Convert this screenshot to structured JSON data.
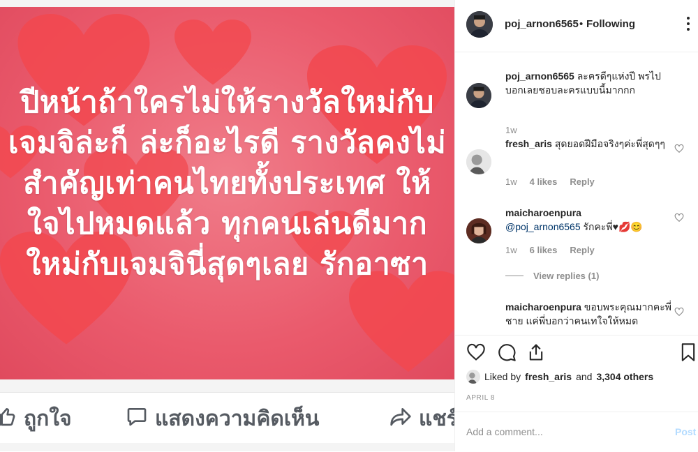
{
  "post": {
    "text": "ปีหน้าถ้าใครไม่ให้รางวัลใหม่กับ\nเจมจิล่ะก็ ล่ะก็อะไรดี รางวัลคงไม่\nสำคัญเท่าคนไทยทั้งประเทศ ให้\nใจไปหมดแล้ว ทุกคนเล่นดีมาก\nใหม่กับเจมจินี่สุดๆเลย รักอาซา",
    "actions": [
      {
        "label": "ถูกใจ",
        "icon": "thumbs-up-icon"
      },
      {
        "label": "แสดงความคิดเห็น",
        "icon": "comment-bubble-icon"
      },
      {
        "label": "แชร์",
        "icon": "share-arrow-icon"
      }
    ],
    "background_color": "#ea5a6c",
    "heart_color": "#f2484f"
  },
  "header": {
    "username": "poj_arnon6565",
    "separator": "•",
    "follow_status": "Following"
  },
  "comments": [
    {
      "username": "poj_arnon6565",
      "text": "ละครดีๆแห่งปี พรไปบอกเลยชอบละครแบบนี้มากกก",
      "time": "1w"
    },
    {
      "username": "fresh_aris",
      "text": "สุดยอดฝีมือจริงๆค่ะพี่สุดๆๆ",
      "time": "1w",
      "likes": "4 likes",
      "reply": "Reply"
    },
    {
      "username": "maicharoenpura",
      "mention": "@poj_arnon6565",
      "text": "รักคะพี่♥💋😊",
      "time": "1w",
      "likes": "6 likes",
      "reply": "Reply",
      "view_replies": "View replies (1)"
    },
    {
      "username": "maicharoenpura",
      "text": "ขอบพระคุณมากคะพี่ชาย แค่พี่บอกว่าคนเทใจให้หมด"
    }
  ],
  "liked_by": {
    "prefix": "Liked by",
    "user": "fresh_aris",
    "and": "and",
    "others": "3,304 others"
  },
  "date": "APRIL 8",
  "add_comment": {
    "placeholder": "Add a comment...",
    "post_label": "Post"
  },
  "colors": {
    "link": "#003569",
    "muted": "#8e8e8e",
    "post_button_disabled": "#b3dbff"
  }
}
